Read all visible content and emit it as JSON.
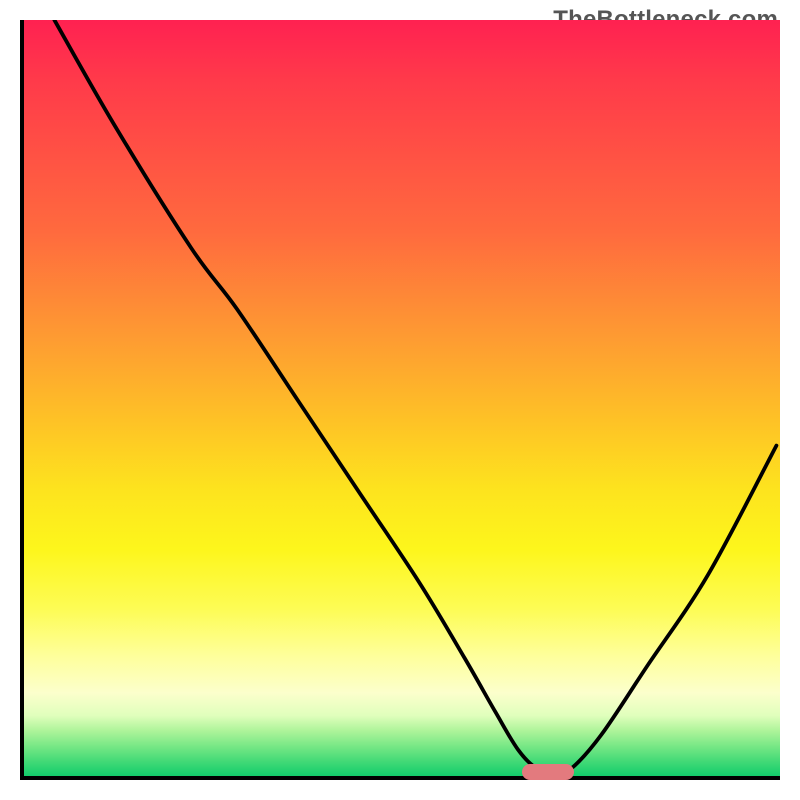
{
  "attribution": "TheBottleneck.com",
  "colors": {
    "gradient_top": "#ff2151",
    "gradient_mid1": "#fe9b32",
    "gradient_mid2": "#fdf61c",
    "gradient_bottom": "#12cd6b",
    "line": "#000000",
    "marker": "#e37a7e",
    "axis": "#000000"
  },
  "chart_data": {
    "type": "line",
    "title": "",
    "xlabel": "",
    "ylabel": "",
    "xlim": [
      0,
      100
    ],
    "ylim": [
      0,
      100
    ],
    "grid": false,
    "legend": false,
    "background": "vertical-gradient red->orange->yellow->green",
    "series": [
      {
        "name": "bottleneck-curve",
        "x": [
          4,
          12,
          22,
          28,
          36,
          44,
          52,
          58,
          62,
          65,
          67.5,
          70,
          72,
          76,
          82,
          90,
          99
        ],
        "values": [
          100,
          86,
          70,
          62,
          50,
          38,
          26,
          16,
          9,
          4,
          1.5,
          1,
          1.5,
          6,
          15,
          27,
          44
        ]
      }
    ],
    "marker": {
      "x": 69,
      "y": 1,
      "shape": "pill",
      "color": "#e37a7e"
    }
  }
}
